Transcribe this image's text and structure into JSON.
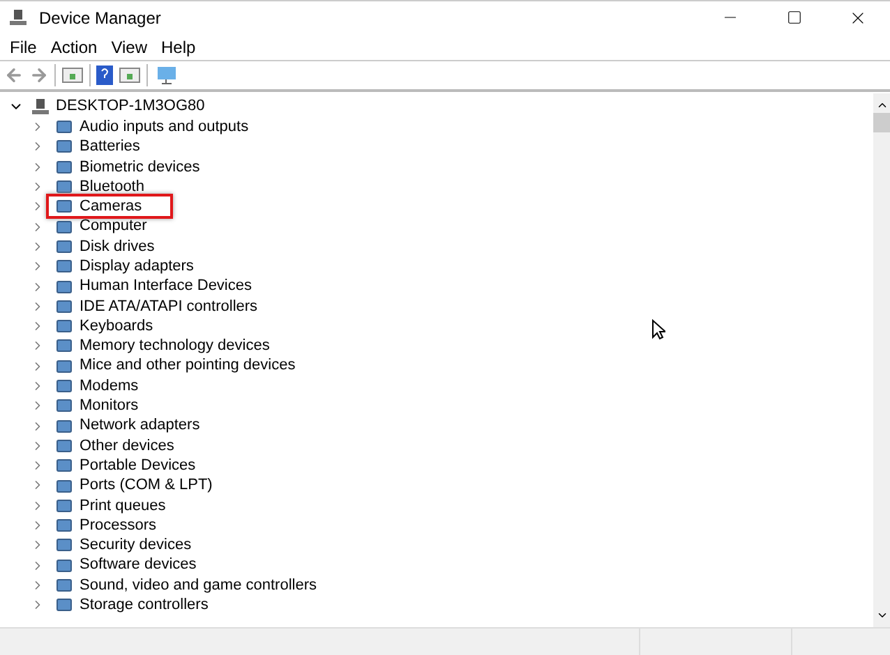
{
  "window": {
    "title": "Device Manager"
  },
  "menu": [
    "File",
    "Action",
    "View",
    "Help"
  ],
  "tree": {
    "label": "DESKTOP-1M3OG80",
    "expanded": true,
    "children": [
      {
        "label": "Audio inputs and outputs",
        "highlighted": false
      },
      {
        "label": "Batteries",
        "highlighted": false
      },
      {
        "label": "Biometric devices",
        "highlighted": false
      },
      {
        "label": "Bluetooth",
        "highlighted": false
      },
      {
        "label": "Cameras",
        "highlighted": true
      },
      {
        "label": "Computer",
        "highlighted": false
      },
      {
        "label": "Disk drives",
        "highlighted": false
      },
      {
        "label": "Display adapters",
        "highlighted": false
      },
      {
        "label": "Human Interface Devices",
        "highlighted": false
      },
      {
        "label": "IDE ATA/ATAPI controllers",
        "highlighted": false
      },
      {
        "label": "Keyboards",
        "highlighted": false
      },
      {
        "label": "Memory technology devices",
        "highlighted": false
      },
      {
        "label": "Mice and other pointing devices",
        "highlighted": false
      },
      {
        "label": "Modems",
        "highlighted": false
      },
      {
        "label": "Monitors",
        "highlighted": false
      },
      {
        "label": "Network adapters",
        "highlighted": false
      },
      {
        "label": "Other devices",
        "highlighted": false
      },
      {
        "label": "Portable Devices",
        "highlighted": false
      },
      {
        "label": "Ports (COM & LPT)",
        "highlighted": false
      },
      {
        "label": "Print queues",
        "highlighted": false
      },
      {
        "label": "Processors",
        "highlighted": false
      },
      {
        "label": "Security devices",
        "highlighted": false
      },
      {
        "label": "Software devices",
        "highlighted": false
      },
      {
        "label": "Sound, video and game controllers",
        "highlighted": false
      },
      {
        "label": "Storage controllers",
        "highlighted": false
      }
    ]
  }
}
